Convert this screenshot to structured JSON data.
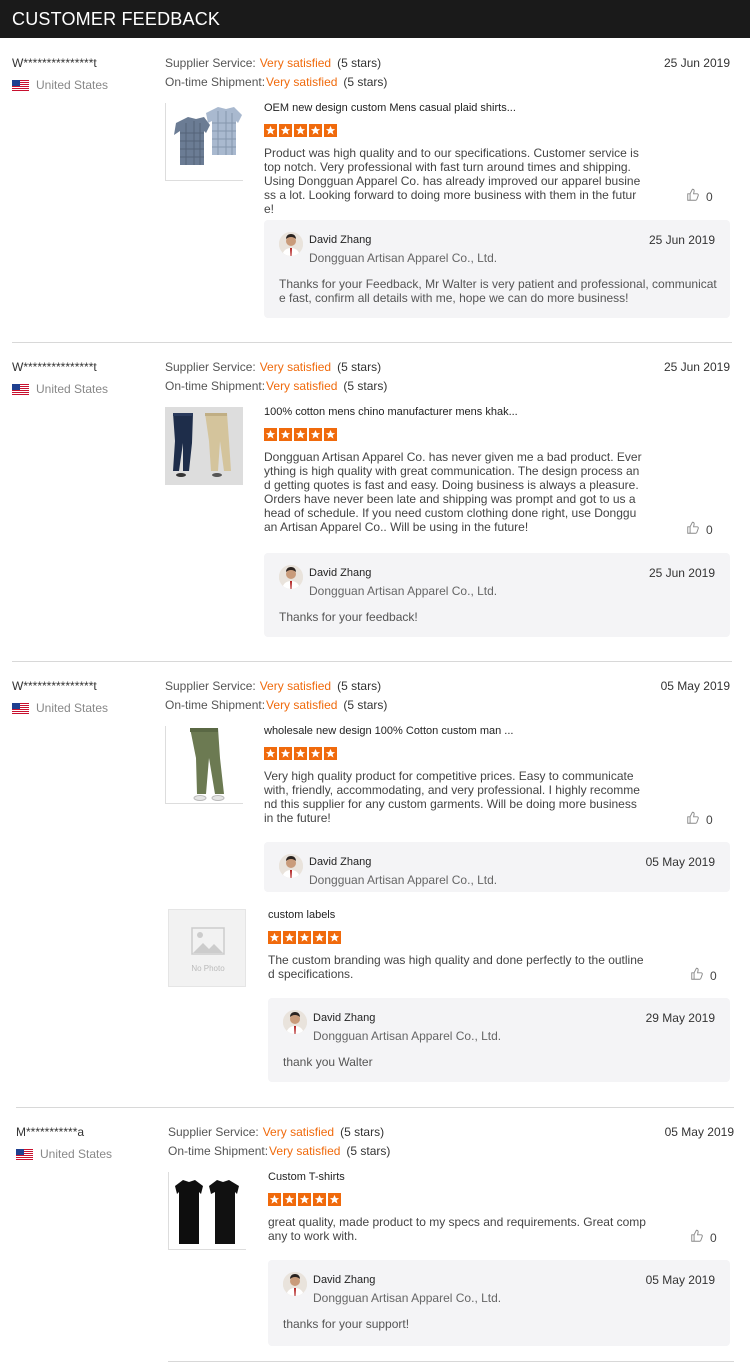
{
  "header": {
    "title": "CUSTOMER FEEDBACK"
  },
  "labels": {
    "supplier_service": "Supplier Service:",
    "ontime_shipment": "On-time Shipment:"
  },
  "feedbacks": [
    {
      "buyer": "W***************t",
      "country": "United States",
      "supplier_service": "Very satisfied",
      "supplier_stars": "(5 stars)",
      "shipment": "Very satisfied",
      "shipment_stars": "(5 stars)",
      "date": "25 Jun 2019",
      "product_title": "OEM new design custom Mens casual plaid shirts...",
      "rating": 5,
      "comment": "Product was high quality and to our specifications. Customer service is top notch. Very professional with fast turn around times and shipping. Using Dongguan Apparel Co. has already improved our apparel business a lot. Looking forward to doing more business with them in the future!",
      "likes": "0",
      "reply": {
        "name": "David Zhang",
        "company": "Dongguan Artisan Apparel Co., Ltd.",
        "date": "25 Jun 2019",
        "text": "Thanks for your Feedback, Mr Walter is very patient and professional, communicate fast, confirm all details with me, hope we can do more business!"
      }
    },
    {
      "buyer": "W***************t",
      "country": "United States",
      "supplier_service": "Very satisfied",
      "supplier_stars": "(5 stars)",
      "shipment": "Very satisfied",
      "shipment_stars": "(5 stars)",
      "date": "25 Jun 2019",
      "product_title": "100% cotton mens chino manufacturer mens khak...",
      "rating": 5,
      "comment": "Dongguan Artisan Apparel Co. has never given me a bad product. Everything is high quality with great communication. The design process and getting quotes is fast and easy. Doing business is always a pleasure. Orders have never been late and shipping was prompt and got to us ahead of schedule. If you need custom clothing done right, use Dongguan Artisan Apparel Co.. Will be using in the future!",
      "likes": "0",
      "reply": {
        "name": "David Zhang",
        "company": "Dongguan Artisan Apparel Co., Ltd.",
        "date": "25 Jun 2019",
        "text": "Thanks for your feedback!"
      }
    },
    {
      "buyer": "W***************t",
      "country": "United States",
      "supplier_service": "Very satisfied",
      "supplier_stars": "(5 stars)",
      "shipment": "Very satisfied",
      "shipment_stars": "(5 stars)",
      "date": "05 May 2019",
      "product_title": "wholesale new design 100% Cotton custom man ...",
      "rating": 5,
      "comment": "Very high quality product for competitive prices. Easy to communicate with, friendly, accommodating, and very professional. I highly recommend this supplier for any custom garments. Will be doing more business in the future!",
      "likes": "0",
      "reply": {
        "name": "David Zhang",
        "company": "Dongguan Artisan Apparel Co., Ltd.",
        "date": "05 May 2019",
        "text": ""
      },
      "extra": {
        "no_photo_label": "No Photo",
        "product_title": "custom labels",
        "rating": 5,
        "comment": "The custom branding was high quality and done perfectly to the outlined specifications.",
        "likes": "0",
        "reply": {
          "name": "David Zhang",
          "company": "Dongguan Artisan Apparel Co., Ltd.",
          "date": "29 May 2019",
          "text": "thank you Walter"
        }
      }
    },
    {
      "buyer": "M***********a",
      "country": "United States",
      "supplier_service": "Very satisfied",
      "supplier_stars": "(5 stars)",
      "shipment": "Very satisfied",
      "shipment_stars": "(5 stars)",
      "date": "05 May 2019",
      "product_title": "Custom T-shirts",
      "rating": 5,
      "comment": "great quality, made product to my specs and requirements. Great company to work with.",
      "likes": "0",
      "reply": {
        "name": "David Zhang",
        "company": "Dongguan Artisan Apparel Co., Ltd.",
        "date": "05 May 2019",
        "text": "thanks for your support!"
      }
    }
  ],
  "colors": {
    "accent": "#f06a0c",
    "header_bg": "#1a1a1a",
    "reply_bg": "#f4f4f6"
  }
}
